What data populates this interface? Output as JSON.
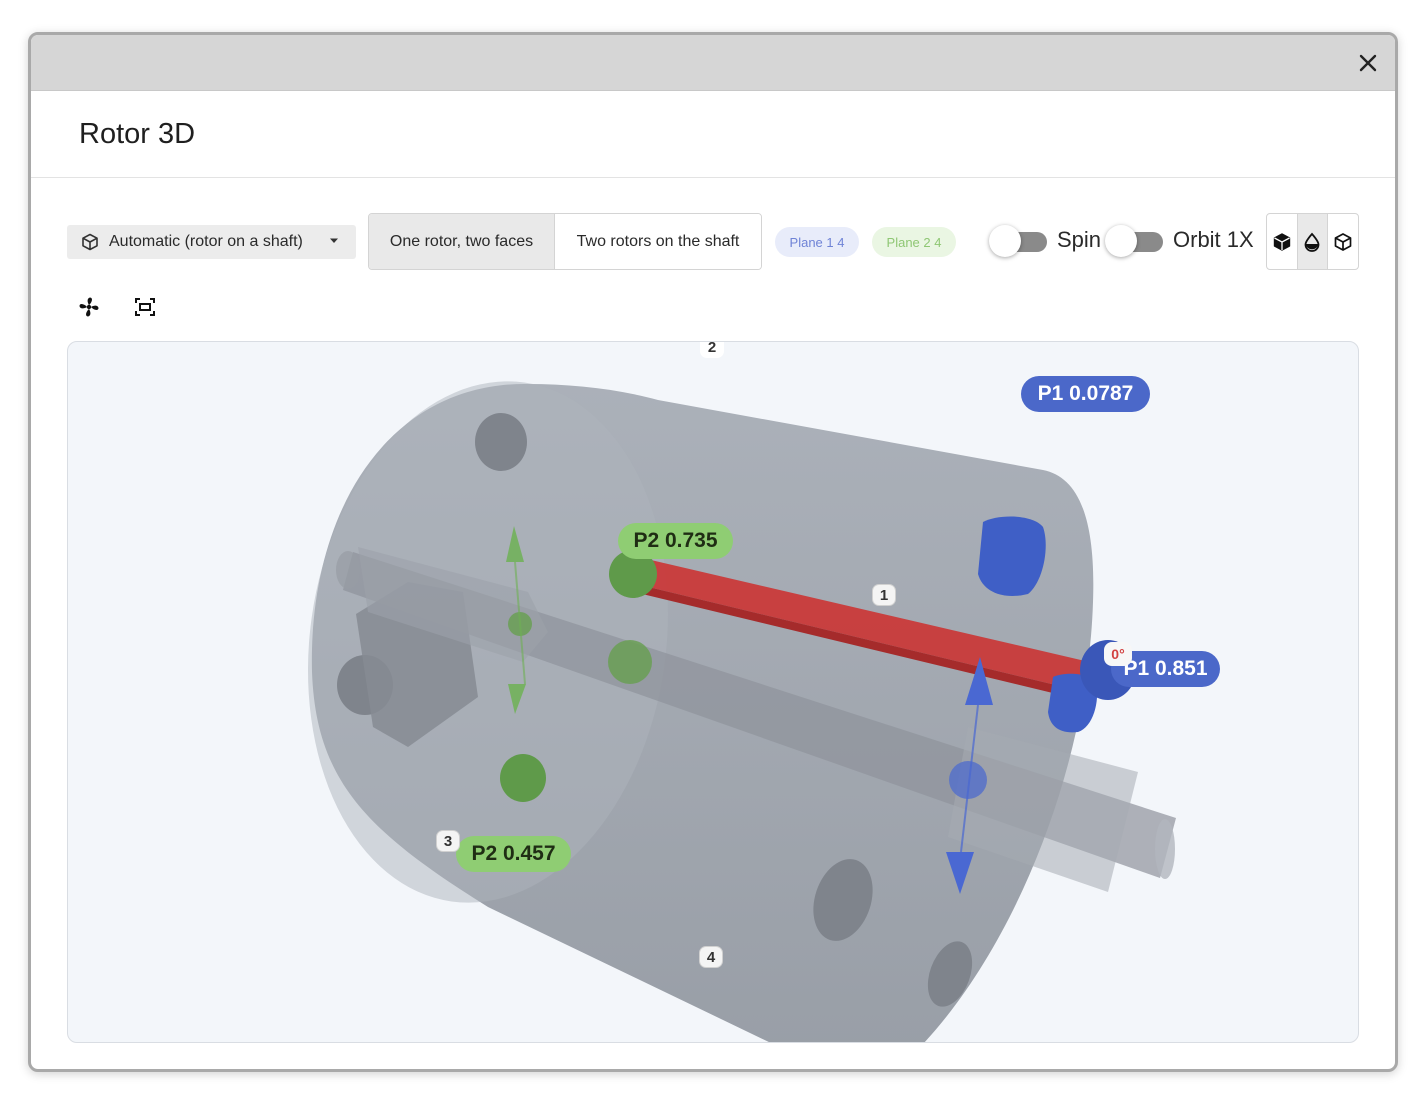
{
  "window": {
    "title": "Rotor 3D"
  },
  "toolbar": {
    "mode_select": {
      "label": "Automatic (rotor on a shaft)",
      "icon": "cube-outline-icon"
    },
    "segments": [
      {
        "label": "One rotor, two faces",
        "active": true
      },
      {
        "label": "Two rotors on the shaft",
        "active": false
      }
    ],
    "chips": [
      {
        "label": "Plane 1 4",
        "color": "#6f83d6"
      },
      {
        "label": "Plane 2 4",
        "color": "#8fc774"
      }
    ],
    "toggles": {
      "spin": {
        "label": "Spin",
        "on": false
      },
      "orbit": {
        "label": "Orbit 1X",
        "on": false
      }
    },
    "render_modes": [
      {
        "icon": "solid-cube-icon"
      },
      {
        "icon": "drop-half-icon",
        "active": true
      },
      {
        "icon": "wireframe-cube-icon"
      }
    ]
  },
  "icon_row": [
    {
      "icon": "fan-icon"
    },
    {
      "icon": "frame-icon"
    }
  ],
  "viewport": {
    "labels": {
      "p1_top": "P1 0.0787",
      "p1_right": "P1 0.851",
      "p2_top": "P2 0.735",
      "p2_bottom": "P2 0.457"
    },
    "markers": {
      "m1": "1",
      "m2": "2",
      "m3": "3",
      "m4": "4"
    },
    "angle": "0°",
    "colors": {
      "plane1": "#3f5fc6",
      "plane2": "#6faa52",
      "shaft_bar": "#c93a3a",
      "rotor_body": "#9ea4ad"
    }
  }
}
